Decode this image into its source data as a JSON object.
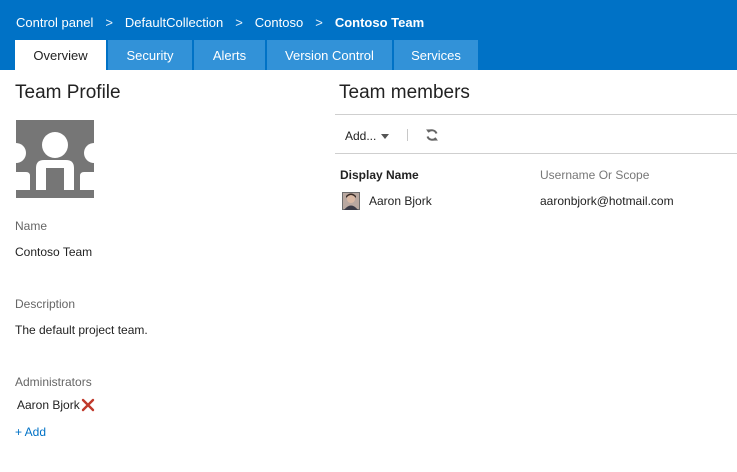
{
  "breadcrumb": {
    "items": [
      "Control panel",
      "DefaultCollection",
      "Contoso"
    ],
    "separator": ">",
    "current": "Contoso Team"
  },
  "tabs": [
    {
      "label": "Overview",
      "active": true
    },
    {
      "label": "Security",
      "active": false
    },
    {
      "label": "Alerts",
      "active": false
    },
    {
      "label": "Version Control",
      "active": false
    },
    {
      "label": "Services",
      "active": false
    }
  ],
  "profile": {
    "title": "Team Profile",
    "name_label": "Name",
    "name_value": "Contoso Team",
    "description_label": "Description",
    "description_value": "The default project team.",
    "administrators_label": "Administrators",
    "administrators": [
      "Aaron Bjork"
    ],
    "add_label": "+ Add"
  },
  "members": {
    "title": "Team members",
    "add_menu_label": "Add...",
    "columns": [
      "Display Name",
      "Username Or Scope"
    ],
    "rows": [
      {
        "display_name": "Aaron Bjork",
        "username": "aaronbjork@hotmail.com"
      }
    ]
  },
  "colors": {
    "header_bg": "#0072c6",
    "tab_inactive_bg": "#3292d8",
    "link": "#0072c6",
    "remove_icon": "#c0392b"
  },
  "icons": {
    "team": "team-avatar-icon",
    "remove": "remove-x-icon",
    "refresh": "refresh-icon",
    "caret": "chevron-down-icon"
  }
}
